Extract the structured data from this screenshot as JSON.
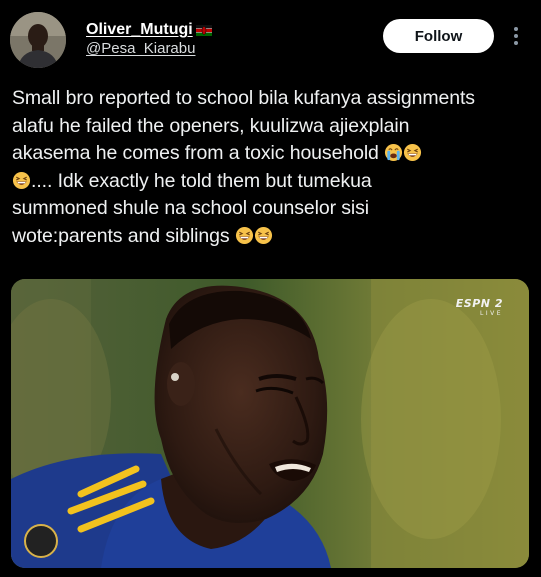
{
  "author": {
    "display_name": "Oliver_Mutugi",
    "flag_icon": "kenya-flag-icon",
    "handle": "@Pesa_Kiarabu"
  },
  "actions": {
    "follow_label": "Follow",
    "more_icon": "more-vertical-icon"
  },
  "tweet": {
    "lines": [
      "Small bro reported to school bila kufanya assignments",
      "alafu he failed the openers, kuulizwa ajiexplain",
      "akasema he comes from a toxic household",
      ".... Idk exactly he told them but tumekua",
      "summoned shule na school counselor sisi",
      "wote:parents and siblings"
    ],
    "emojis": [
      "loudly-crying-face-emoji",
      "grinning-squinting-face-emoji"
    ]
  },
  "media": {
    "description_icon": "photo-crying-footballer",
    "watermark_main": "ESPN 2",
    "watermark_sub": "LIVE"
  },
  "colors": {
    "background": "#000000",
    "text": "#e7e9ea",
    "follow_bg": "#ffffff",
    "follow_text": "#0f1419"
  }
}
